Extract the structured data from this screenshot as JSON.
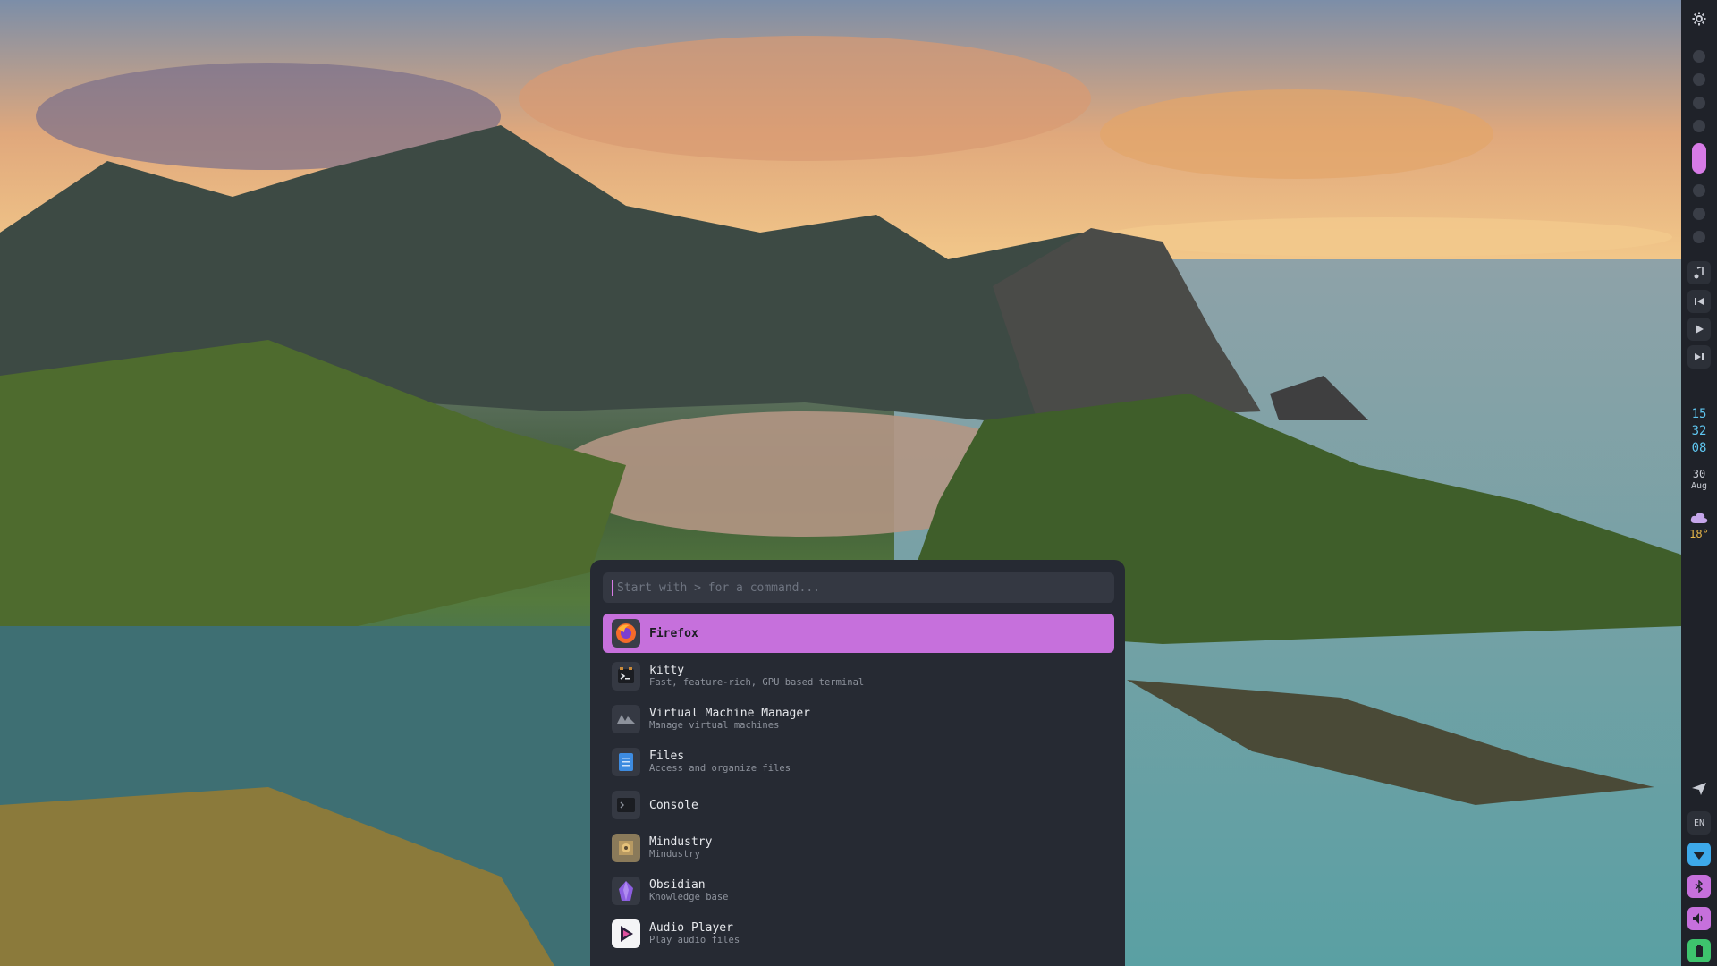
{
  "bar": {
    "settings_icon": "gear-icon",
    "clock": {
      "hour": "15",
      "minute": "32",
      "second": "08"
    },
    "date": {
      "day": "30",
      "month": "Aug"
    },
    "weather": {
      "icon": "cloud-icon",
      "temp": "18°"
    },
    "language": "EN",
    "colors": {
      "accent": "#d77be6",
      "wifi": "#3da9ea",
      "green": "#3ec46d"
    }
  },
  "launcher": {
    "search": {
      "placeholder": "Start with > for a command...",
      "value": ""
    },
    "apps": [
      {
        "name": "Firefox",
        "desc": "",
        "icon": "firefox-icon",
        "selected": true
      },
      {
        "name": "kitty",
        "desc": "Fast, feature-rich, GPU based terminal",
        "icon": "terminal-icon"
      },
      {
        "name": "Virtual Machine Manager",
        "desc": "Manage virtual machines",
        "icon": "vm-manager-icon"
      },
      {
        "name": "Files",
        "desc": "Access and organize files",
        "icon": "files-icon"
      },
      {
        "name": "Console",
        "desc": "",
        "icon": "console-icon"
      },
      {
        "name": "Mindustry",
        "desc": "Mindustry",
        "icon": "mindustry-icon"
      },
      {
        "name": "Obsidian",
        "desc": "Knowledge base",
        "icon": "obsidian-icon"
      },
      {
        "name": "Audio Player",
        "desc": "Play audio files",
        "icon": "audio-player-icon"
      }
    ]
  }
}
